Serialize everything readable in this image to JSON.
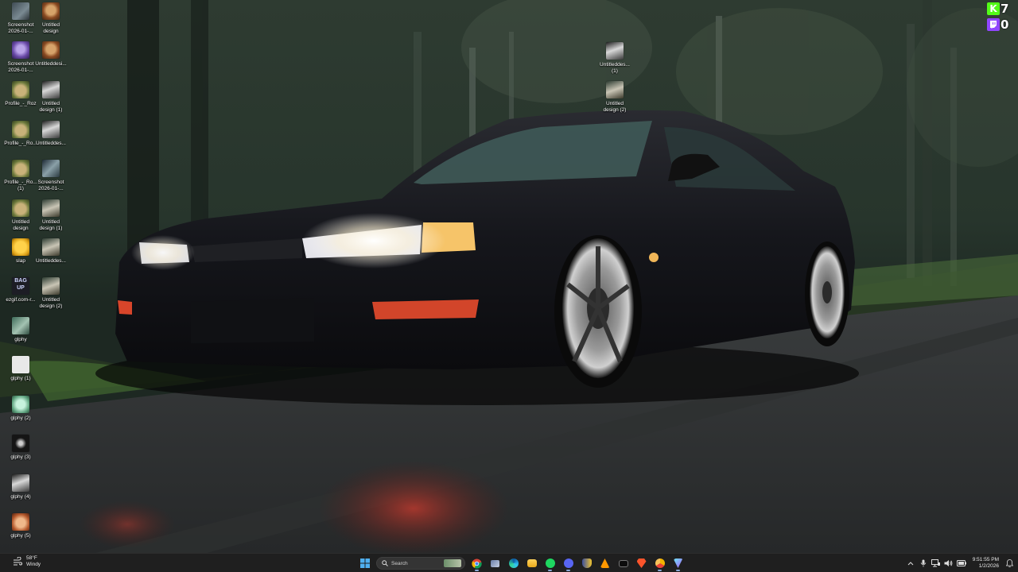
{
  "desktop": {
    "icons_left": [
      {
        "label": "Screenshot\n2026-01-...",
        "thumb": "t-screen",
        "name": "screenshot-file"
      },
      {
        "label": "Untitled\ndesign",
        "thumb": "t-cat",
        "name": "untitled-design-file"
      },
      {
        "label": "Screenshot\n2026-01-...",
        "thumb": "t-purple",
        "name": "screenshot-file"
      },
      {
        "label": "Untitleddesi...",
        "thumb": "t-cat",
        "name": "untitled-design-file"
      },
      {
        "label": "Profile_-_Roz",
        "thumb": "t-frog",
        "name": "profile-roz-file"
      },
      {
        "label": "Untitled\ndesign (1)",
        "thumb": "t-grey",
        "name": "untitled-design-file"
      },
      {
        "label": "Profile_-_Ro...",
        "thumb": "t-frog",
        "name": "profile-roz-file"
      },
      {
        "label": "Untitleddes...",
        "thumb": "t-grey",
        "name": "untitled-design-file"
      },
      {
        "label": "Profile_-_Ro...\n(1)",
        "thumb": "t-frog",
        "name": "profile-roz-file"
      },
      {
        "label": "Screenshot\n2026-01-...",
        "thumb": "t-screen2",
        "name": "screenshot-file"
      },
      {
        "label": "Untitled\ndesign",
        "thumb": "t-frog",
        "name": "untitled-design-file"
      },
      {
        "label": "Untitled\ndesign (1)",
        "thumb": "t-figure",
        "name": "untitled-design-file"
      },
      {
        "label": "slap",
        "thumb": "t-yellow",
        "name": "slap-file"
      },
      {
        "label": "Untitleddes...",
        "thumb": "t-figure",
        "name": "untitled-design-file"
      },
      {
        "label": "ezgif.com-r...",
        "thumb": "t-bag",
        "name": "ezgif-file",
        "badge": "BAG\nUP"
      },
      {
        "label": "Untitled\ndesign (2)",
        "thumb": "t-figure",
        "name": "untitled-design-file"
      },
      {
        "label": "glphy",
        "thumb": "t-green",
        "name": "glphy-file"
      },
      {
        "label": "glphy (1)",
        "thumb": "t-white",
        "name": "glphy-file"
      },
      {
        "label": "glphy (2)",
        "thumb": "t-mint",
        "name": "glphy-file"
      },
      {
        "label": "glphy (3)",
        "thumb": "t-dark",
        "name": "glphy-file"
      },
      {
        "label": "glphy (4)",
        "thumb": "t-grey",
        "name": "glphy-file"
      },
      {
        "label": "glphy (5)",
        "thumb": "t-fox",
        "name": "glphy-file"
      }
    ],
    "icons_mid": [
      {
        "label": "Untitleddes...\n(1)",
        "thumb": "t-grey",
        "name": "untitled-design-file"
      },
      {
        "label": "Untitled\ndesign (2)",
        "thumb": "t-figure",
        "name": "untitled-design-file"
      }
    ]
  },
  "overlay": {
    "kick": {
      "letter": "K",
      "count": "7",
      "color": "#53fc18"
    },
    "twitch": {
      "count": "0",
      "color": "#9146ff"
    }
  },
  "taskbar": {
    "weather": {
      "temp": "58°F",
      "condition": "Windy"
    },
    "search_placeholder": "Search",
    "apps": [
      "windows-start",
      "search",
      "chrome",
      "task-view",
      "edge",
      "file-explorer",
      "spotify",
      "discord",
      "shield-app",
      "sublime-text",
      "terminal",
      "brave",
      "chrome-canary",
      "vpn-app"
    ],
    "clock": {
      "time": "9:51:55 PM",
      "date": "1/2/2026"
    }
  }
}
